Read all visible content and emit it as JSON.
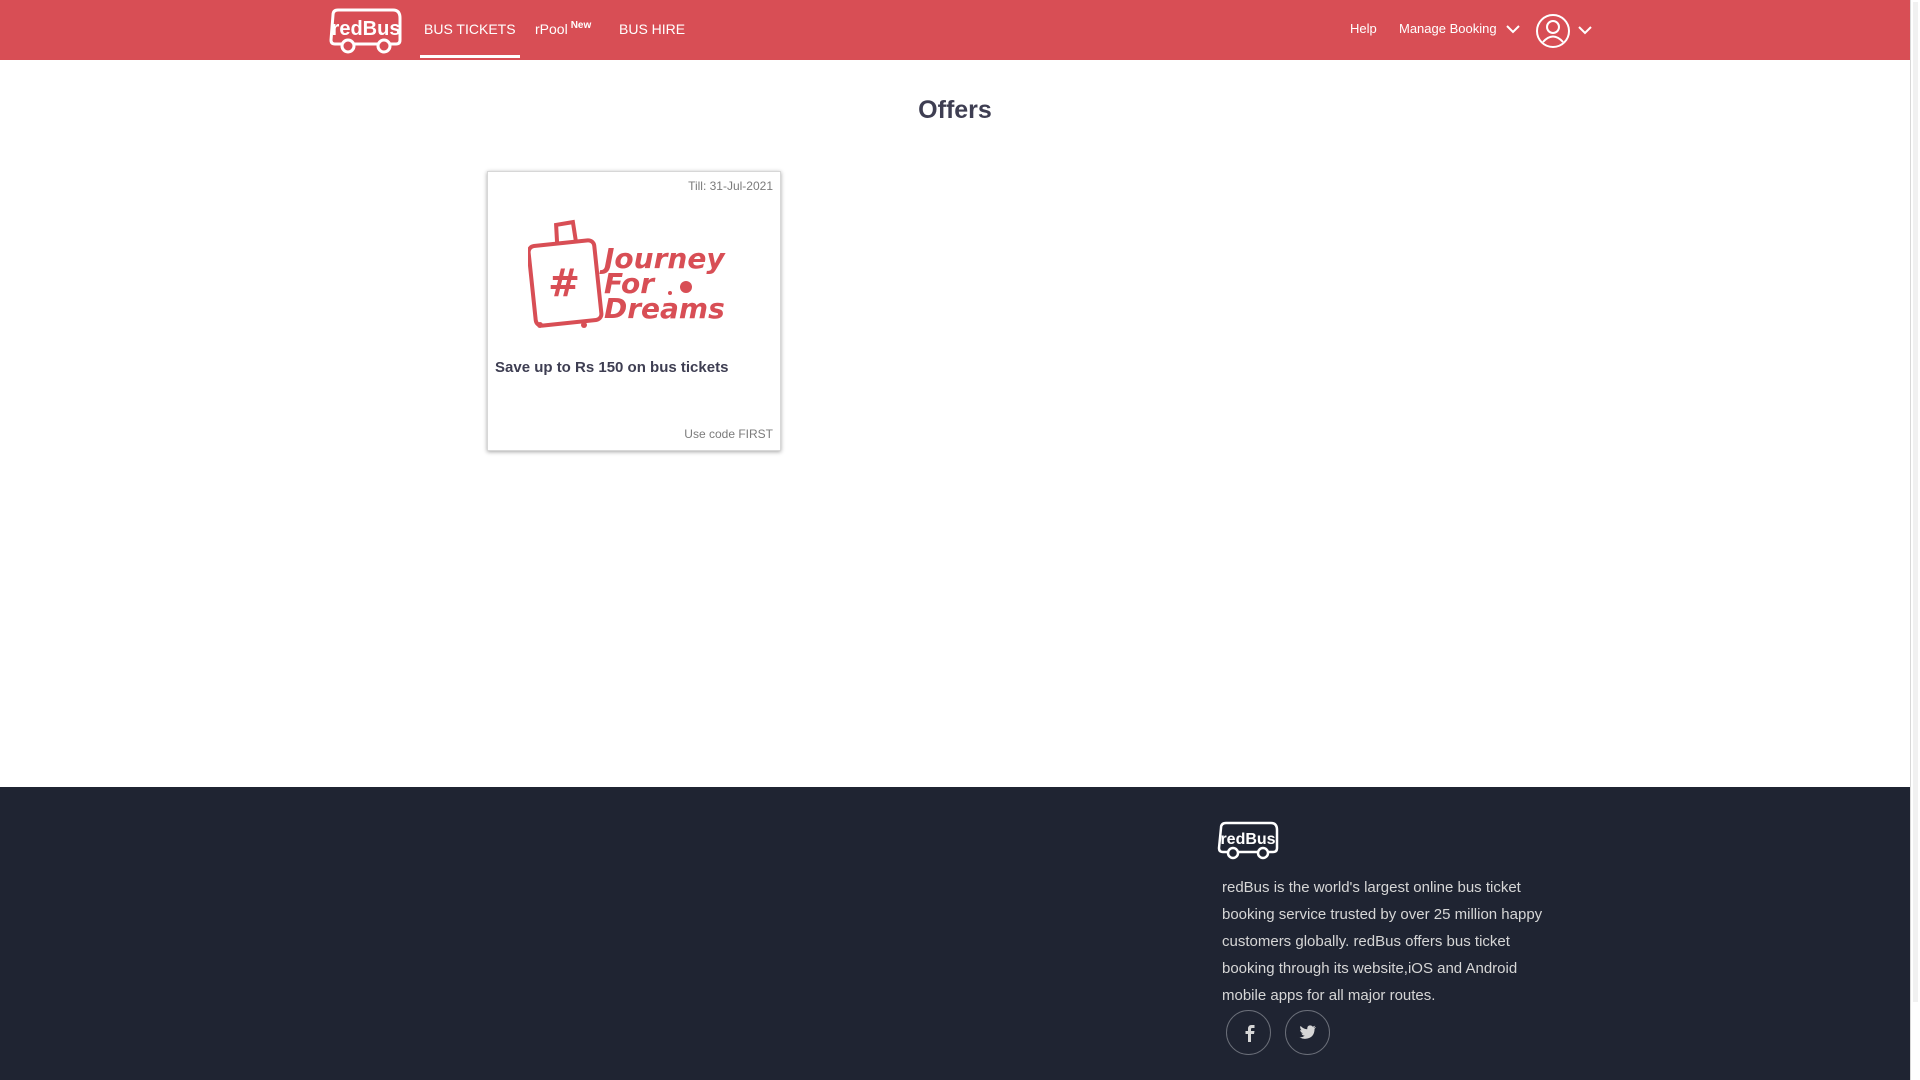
{
  "header": {
    "brand": "redBus",
    "nav": [
      {
        "label": "BUS TICKETS",
        "active": true
      },
      {
        "label": "rPool",
        "badge": "New"
      },
      {
        "label": "BUS HIRE"
      }
    ],
    "help": "Help",
    "manage_booking": "Manage Booking",
    "profile_icon": "user-circle-icon",
    "accent_color": "#d84e55"
  },
  "main": {
    "title": "Offers",
    "offers": [
      {
        "till": "Till: 31-Jul-2021",
        "campaign": "#JourneyForDreams",
        "campaign_lines": [
          "Journey",
          "For",
          "Dreams"
        ],
        "description": "Save up to Rs 150 on bus tickets",
        "code": "Use code FIRST"
      }
    ]
  },
  "footer": {
    "brand": "redBus",
    "description": "redBus is the world's largest online bus ticket booking service trusted by over 25 million happy customers globally. redBus offers bus ticket booking through its website,iOS and Android mobile apps for all major routes.",
    "social": [
      "facebook-icon",
      "twitter-icon"
    ],
    "background_color": "#1f2432"
  }
}
